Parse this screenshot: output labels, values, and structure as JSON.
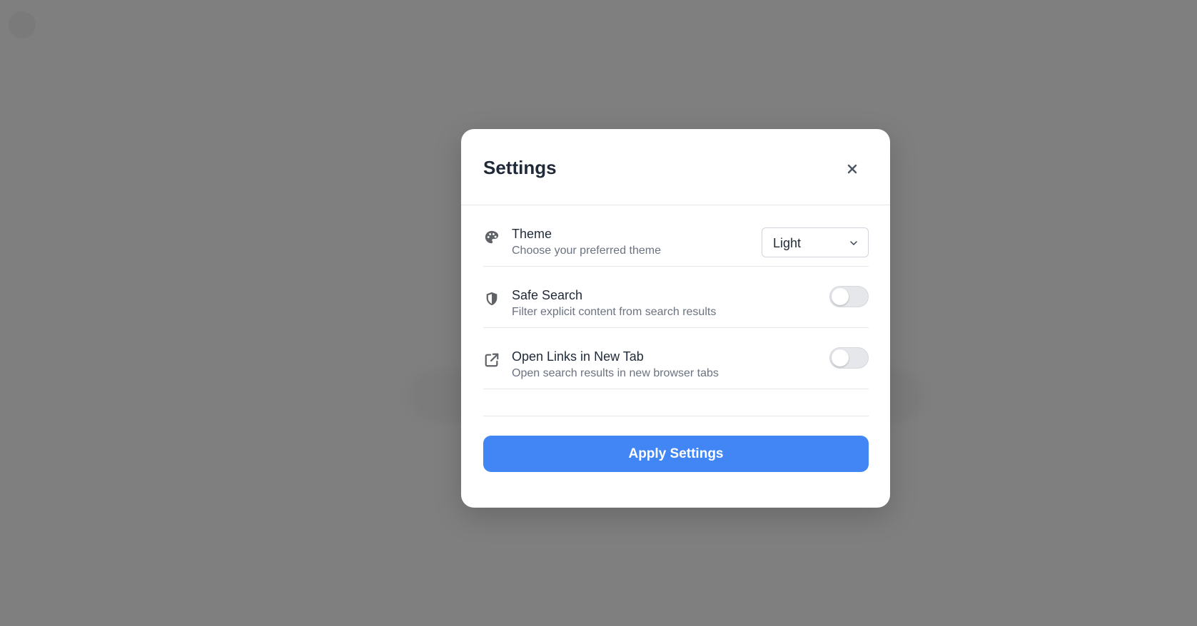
{
  "modal": {
    "title": "Settings",
    "close_icon": "close-icon"
  },
  "settings": [
    {
      "icon": "palette-icon",
      "label": "Theme",
      "description": "Choose your preferred theme",
      "control": "select",
      "value": "Light"
    },
    {
      "icon": "shield-icon",
      "label": "Safe Search",
      "description": "Filter explicit content from search results",
      "control": "toggle",
      "checked": false
    },
    {
      "icon": "external-link-icon",
      "label": "Open Links in New Tab",
      "description": "Open search results in new browser tabs",
      "control": "toggle",
      "checked": false
    }
  ],
  "actions": {
    "apply_label": "Apply Settings"
  },
  "colors": {
    "backdrop": "#7f7f7f",
    "primary": "#4285f4",
    "toggle_off": "#e5e7eb",
    "icon": "#5f6368"
  }
}
